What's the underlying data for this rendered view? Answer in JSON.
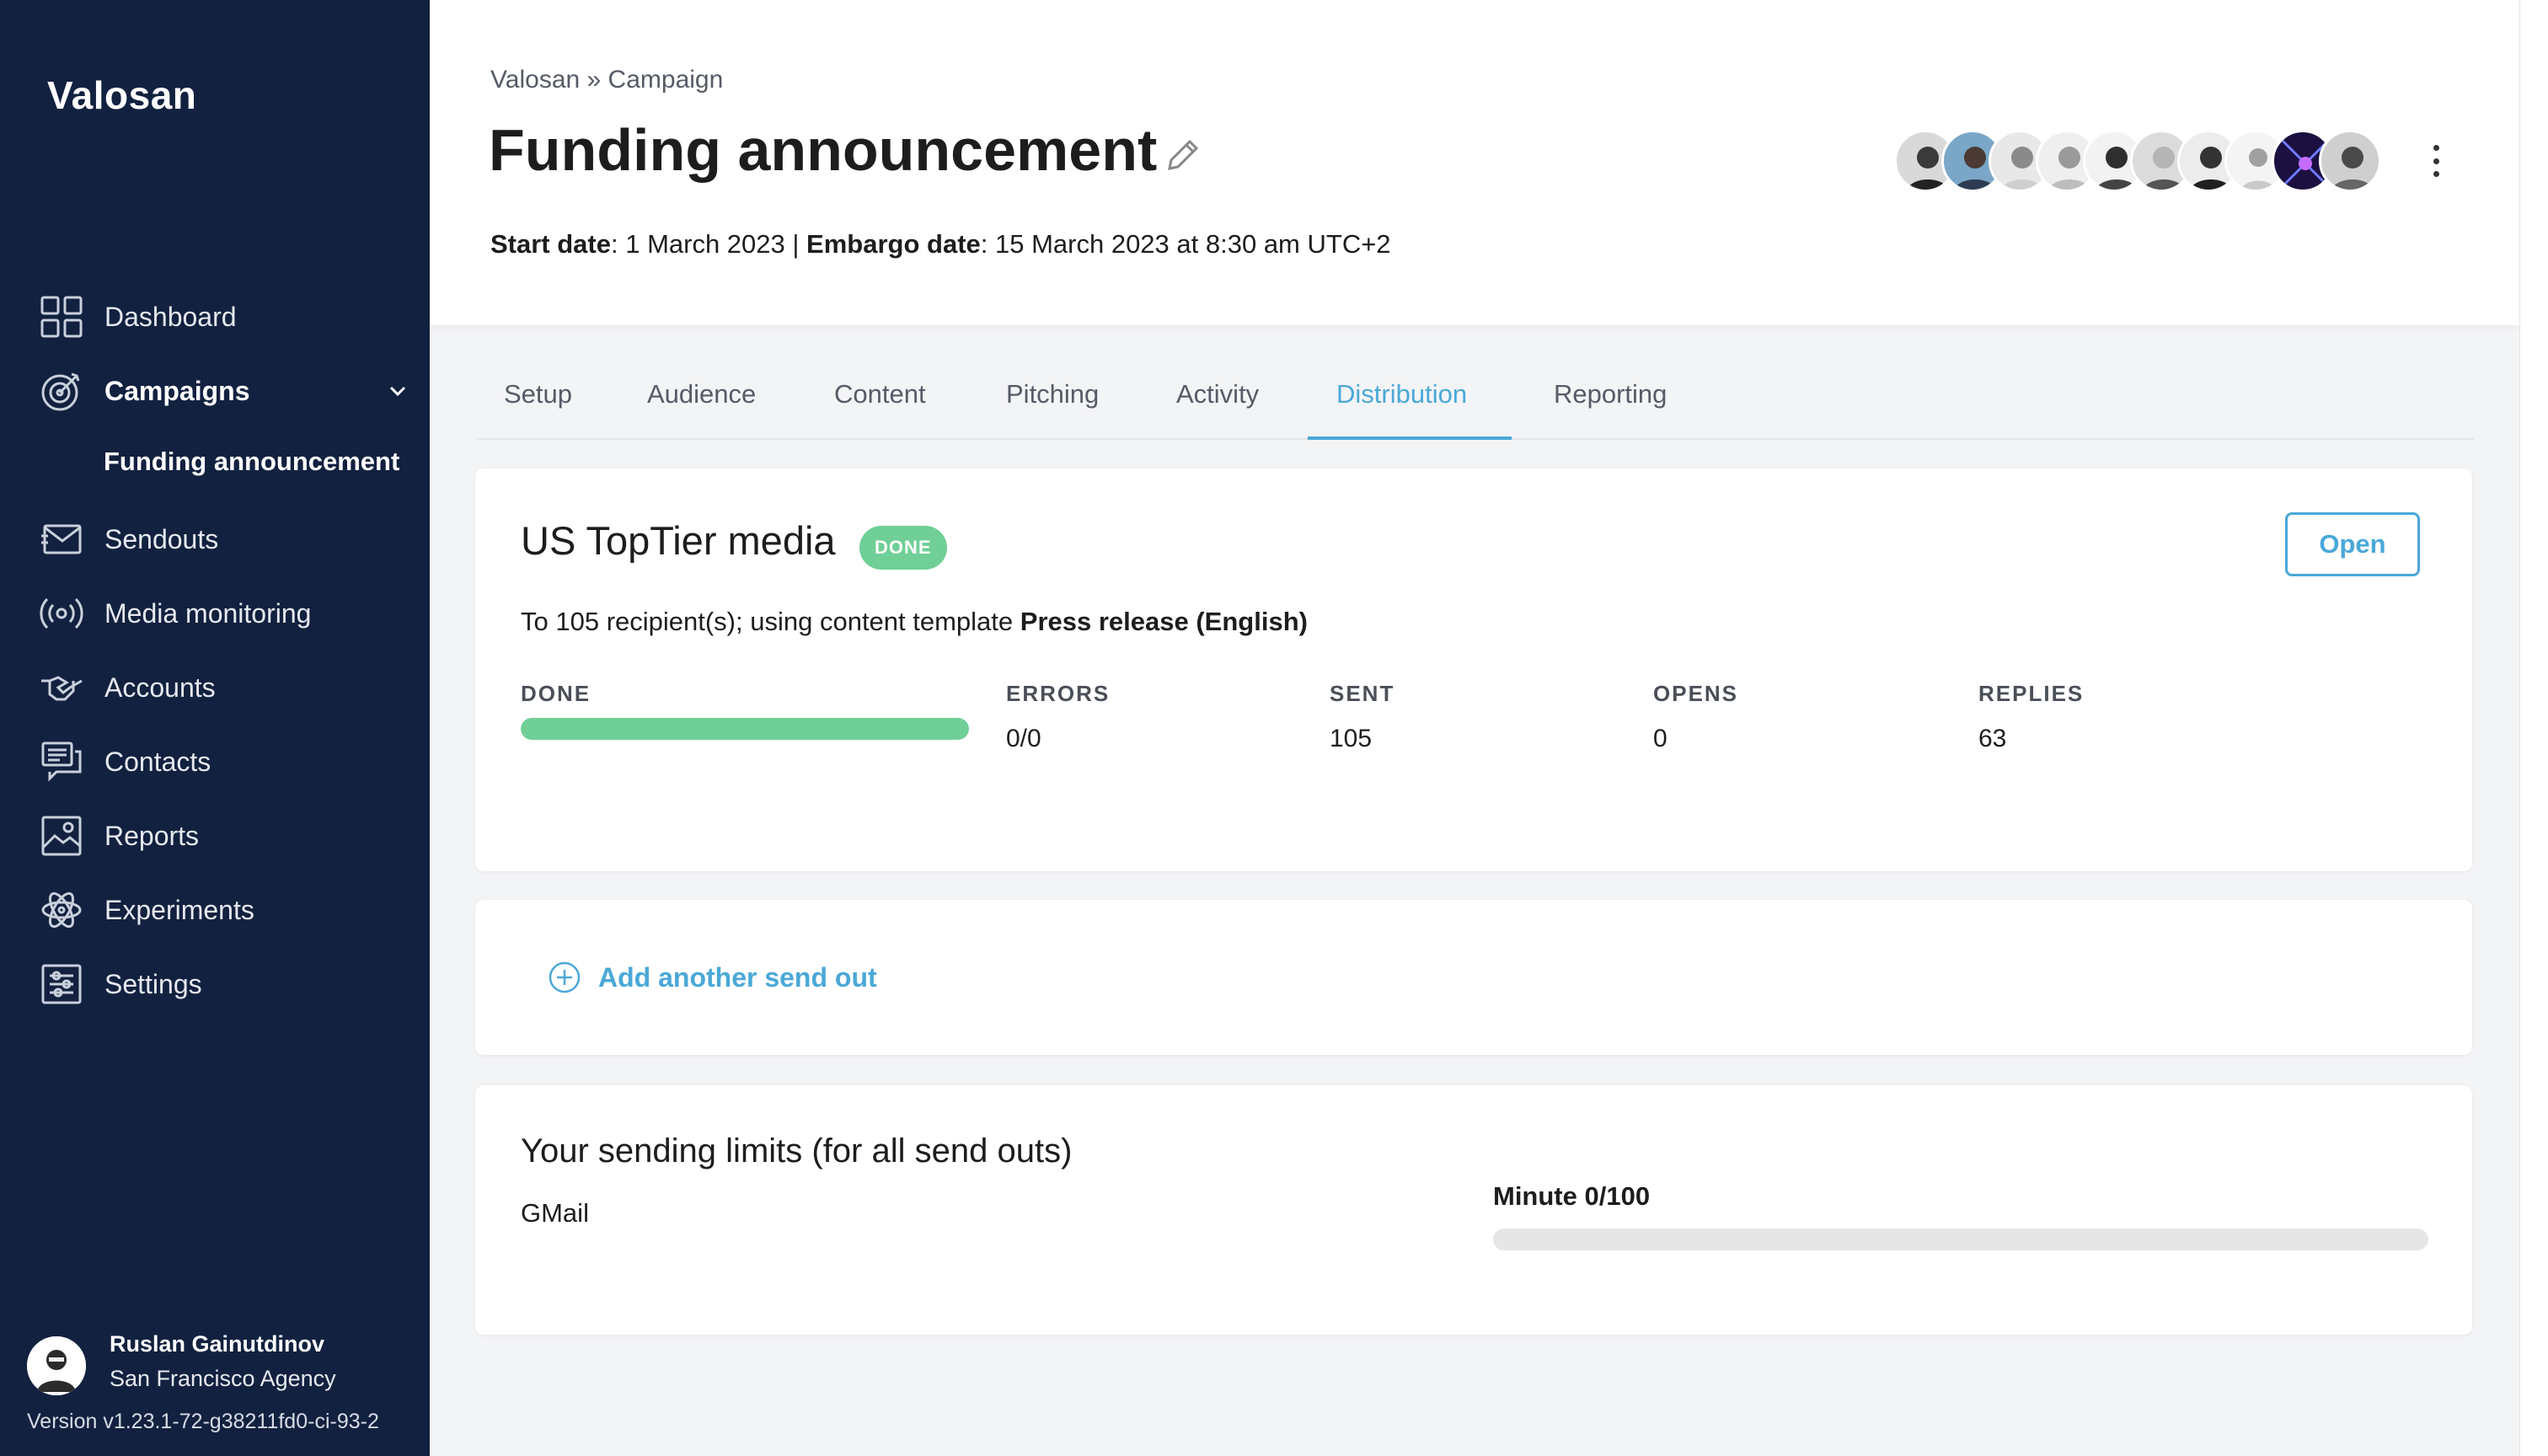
{
  "sidebar": {
    "logo": "Valosan",
    "items": [
      {
        "label": "Dashboard",
        "icon": "dashboard-grid-icon"
      },
      {
        "label": "Campaigns",
        "icon": "target-icon",
        "active": true
      },
      {
        "label": "Sendouts",
        "icon": "envelope-icon"
      },
      {
        "label": "Media monitoring",
        "icon": "broadcast-icon"
      },
      {
        "label": "Accounts",
        "icon": "handshake-icon"
      },
      {
        "label": "Contacts",
        "icon": "chat-bubbles-icon"
      },
      {
        "label": "Reports",
        "icon": "report-image-icon"
      },
      {
        "label": "Experiments",
        "icon": "atom-icon"
      },
      {
        "label": "Settings",
        "icon": "sliders-icon"
      }
    ],
    "sub_item": "Funding announcement",
    "user": {
      "name": "Ruslan Gainutdinov",
      "agency": "San Francisco Agency"
    },
    "version": "Version v1.23.1-72-g38211fd0-ci-93-2"
  },
  "header": {
    "breadcrumb": "Valosan » Campaign",
    "title": "Funding announcement",
    "start_label": "Start date",
    "start_value": ": 1 March 2023 | ",
    "embargo_label": "Embargo date",
    "embargo_value": ": 15 March 2023 at 8:30 am UTC+2",
    "team_avatar_count": 10
  },
  "tabs": [
    "Setup",
    "Audience",
    "Content",
    "Pitching",
    "Activity",
    "Distribution",
    "Reporting"
  ],
  "active_tab": "Distribution",
  "sendout": {
    "title": "US TopTier media",
    "badge": "DONE",
    "open_label": "Open",
    "recipients_prefix": "To 105 recipient(s); using content template ",
    "template_name": "Press release (English)",
    "progress_fraction": 1.0,
    "stats": [
      {
        "label": "DONE",
        "value": ""
      },
      {
        "label": "ERRORS",
        "value": "0/0"
      },
      {
        "label": "SENT",
        "value": "105"
      },
      {
        "label": "OPENS",
        "value": "0"
      },
      {
        "label": "REPLIES",
        "value": "63"
      }
    ]
  },
  "add_sendout": {
    "label": "Add another send out"
  },
  "limits": {
    "title": "Your sending limits (for all send outs)",
    "provider": "GMail",
    "limit_label": "Minute 0/100",
    "limit_fraction": 0.0
  },
  "colors": {
    "sidebar_bg": "#12213f",
    "accent": "#4aa8d8",
    "success": "#6fcf97"
  }
}
